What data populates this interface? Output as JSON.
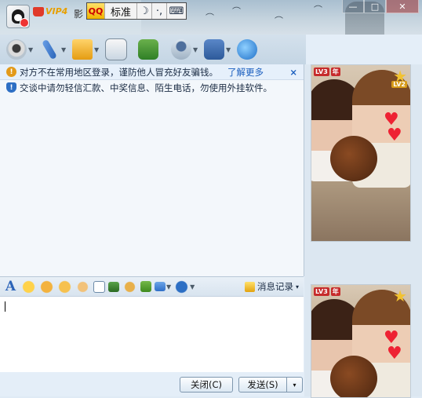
{
  "titlebar": {
    "vip_label": "VIP4",
    "ying_char": "影",
    "ime_logo": "QQ",
    "ime_mode": "标准",
    "ime_moon": "☽",
    "ime_punc": "·,",
    "ime_kb": "⌨",
    "min_symbol": "—",
    "max_symbol": "□",
    "close_symbol": "✕"
  },
  "notices": [
    {
      "text": "对方不在常用地区登录，谨防他人冒充好友骗钱。",
      "link": "了解更多",
      "close": "×"
    },
    {
      "text": "交谈中请勿轻信汇款、中奖信息、陌生电话，勿使用外挂软件。"
    }
  ],
  "fmtbar": {
    "font_icon_label": "A",
    "message_record_label": "消息记录",
    "message_record_caret": "▾"
  },
  "buttons": {
    "close_label": "关闭(C)",
    "send_label": "发送(S)",
    "send_menu": "▾"
  },
  "photos": {
    "badge_level": "LV3",
    "badge_year": "年",
    "level2": "LV2",
    "heart": "♥",
    "star": "★"
  },
  "colors": {
    "accent": "#2d6fc4",
    "link": "#1b5fbf",
    "warn": "#e39a1a"
  }
}
